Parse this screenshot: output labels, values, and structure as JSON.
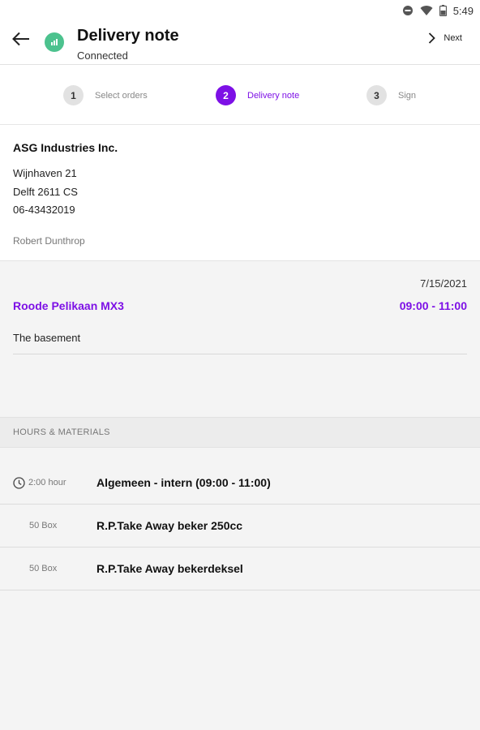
{
  "status_bar": {
    "time": "5:49"
  },
  "app_bar": {
    "title": "Delivery note",
    "subtitle": "Connected",
    "next_label": "Next"
  },
  "stepper": {
    "steps": [
      {
        "number": "1",
        "label": "Select orders",
        "active": false
      },
      {
        "number": "2",
        "label": "Delivery note",
        "active": true
      },
      {
        "number": "3",
        "label": "Sign",
        "active": false
      }
    ]
  },
  "customer": {
    "name": "ASG Industries Inc.",
    "street": "Wijnhaven 21",
    "city": "Delft 2611 CS",
    "phone": "06-43432019",
    "contact": "Robert Dunthrop"
  },
  "order": {
    "date": "7/15/2021",
    "name": "Roode Pelikaan MX3",
    "time": "09:00 - 11:00",
    "location": "The basement"
  },
  "section": {
    "title": "HOURS & MATERIALS"
  },
  "lines": [
    {
      "qty": "2:00 hour",
      "icon": "clock-icon",
      "description": "Algemeen - intern (09:00 - 11:00)"
    },
    {
      "qty": "50 Box",
      "description": "R.P.Take Away beker 250cc"
    },
    {
      "qty": "50 Box",
      "description": "R.P.Take Away bekerdeksel"
    }
  ],
  "colors": {
    "accent": "#7d10e6",
    "connected": "#4cc28e"
  }
}
